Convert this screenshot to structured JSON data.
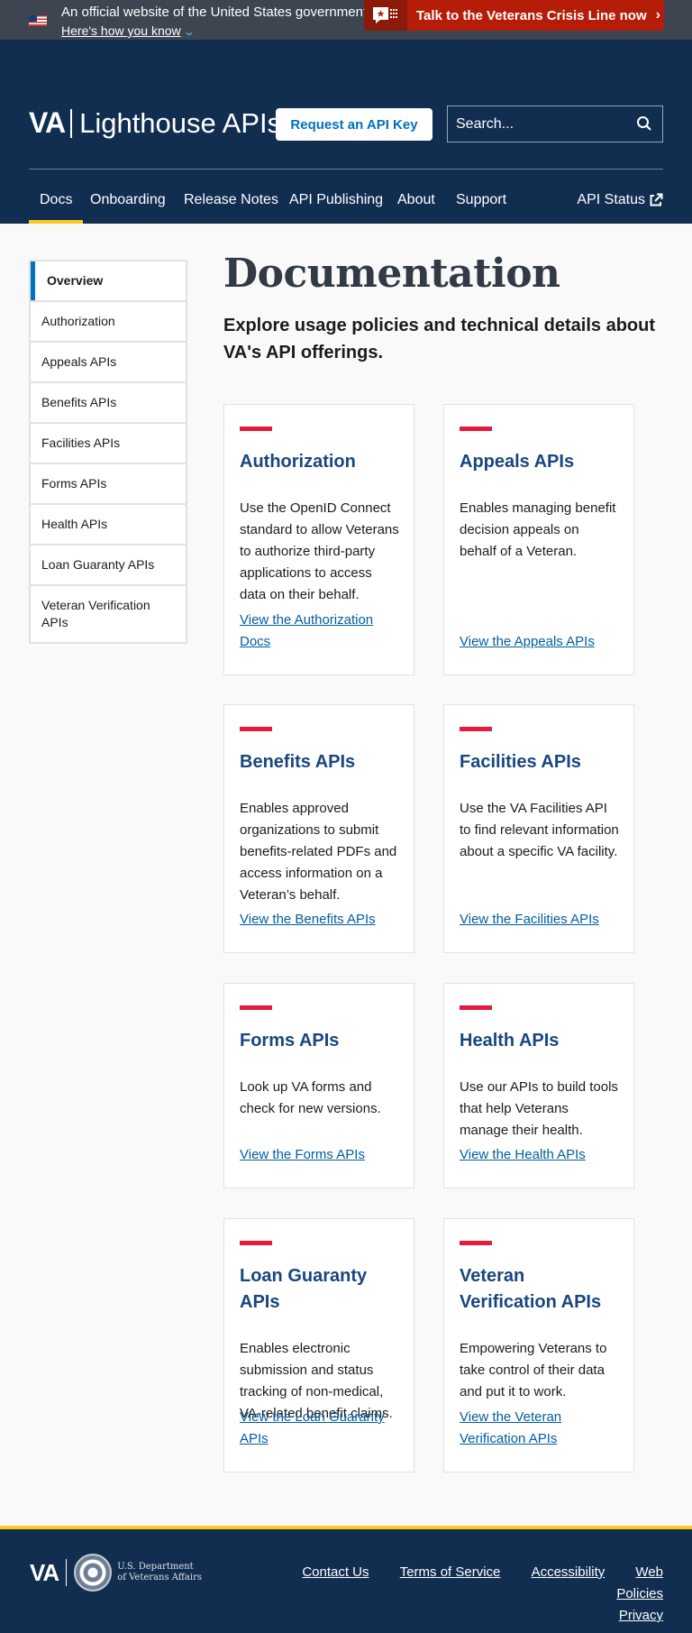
{
  "gov_banner": {
    "official_text": "An official website of the United States government.",
    "how_link": "Here's how you know",
    "crisis_line": "Talk to the Veterans Crisis Line now"
  },
  "header": {
    "logo_va": "VA",
    "logo_product": "Lighthouse APIs",
    "api_key_button": "Request an API Key",
    "search_placeholder": "Search..."
  },
  "nav": {
    "items": [
      {
        "label": "Docs",
        "active": true
      },
      {
        "label": "Onboarding"
      },
      {
        "label": "Release Notes"
      },
      {
        "label": "API Publishing"
      },
      {
        "label": "About"
      },
      {
        "label": "Support"
      }
    ],
    "status_link": "API Status"
  },
  "sidebar": {
    "items": [
      {
        "label": "Overview",
        "active": true
      },
      {
        "label": "Authorization"
      },
      {
        "label": "Appeals APIs"
      },
      {
        "label": "Benefits APIs"
      },
      {
        "label": "Facilities APIs"
      },
      {
        "label": "Forms APIs"
      },
      {
        "label": "Health APIs"
      },
      {
        "label": "Loan Guaranty APIs"
      },
      {
        "label": "Veteran Verification APIs"
      }
    ]
  },
  "main": {
    "title": "Documentation",
    "lead": "Explore usage policies and technical details about VA's API offerings.",
    "cards": [
      {
        "title": "Authorization",
        "description": "Use the OpenID Connect standard to allow Veterans to authorize third-party applications to access data on their behalf.",
        "link": "View the Authorization Docs"
      },
      {
        "title": "Appeals APIs",
        "description": "Enables managing benefit decision appeals on behalf of a Veteran.",
        "link": "View the Appeals APIs"
      },
      {
        "title": "Benefits APIs",
        "description": "Enables approved organizations to submit benefits-related PDFs and access information on a Veteran’s behalf.",
        "link": "View the Benefits APIs"
      },
      {
        "title": "Facilities APIs",
        "description": "Use the VA Facilities API to find relevant information about a specific VA facility.",
        "link": "View the Facilities APIs"
      },
      {
        "title": "Forms APIs",
        "description": "Look up VA forms and check for new versions.",
        "link": "View the Forms APIs"
      },
      {
        "title": "Health APIs",
        "description": "Use our APIs to build tools that help Veterans manage their health.",
        "link": "View the Health APIs"
      },
      {
        "title": "Loan Guaranty APIs",
        "description": "Enables electronic submission and status tracking of non-medical, VA-related benefit claims.",
        "link": "View the Loan Guaranty APIs"
      },
      {
        "title": "Veteran Verification APIs",
        "description": "Empowering Veterans to take control of their data and put it to work.",
        "link": "View the Veteran Verification APIs"
      }
    ]
  },
  "footer": {
    "logo_va": "VA",
    "dept_line1": "U.S. Department",
    "dept_line2": "of Veterans Affairs",
    "links": [
      "Contact Us",
      "Terms of Service",
      "Accessibility",
      "Web Policies",
      "Privacy"
    ]
  },
  "colors": {
    "header_bg": "#112e51",
    "accent_gold": "#fac922",
    "card_bar_red": "#e31c3d",
    "link_blue": "#005ea2",
    "crisis_red": "#b51d09"
  }
}
